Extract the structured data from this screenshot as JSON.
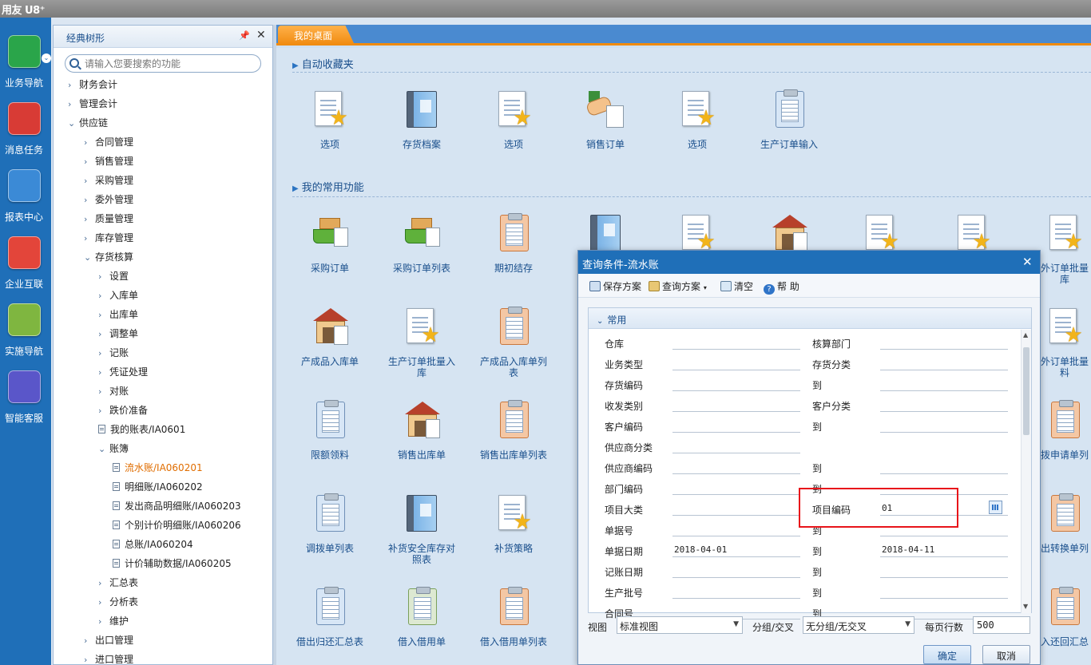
{
  "app": {
    "logo": "用友 U8⁺"
  },
  "rail": [
    {
      "label": "业务导航",
      "icon": "business-nav-icon",
      "color": "#2aa54a"
    },
    {
      "label": "消息任务",
      "icon": "message-icon",
      "color": "#d83b35"
    },
    {
      "label": "报表中心",
      "icon": "report-icon",
      "color": "#3b8ad6"
    },
    {
      "label": "企业互联",
      "icon": "enterprise-icon",
      "color": "#e3453a"
    },
    {
      "label": "实施导航",
      "icon": "compass-icon",
      "color": "#7fb640"
    },
    {
      "label": "智能客服",
      "icon": "support-icon",
      "color": "#5a56c9"
    }
  ],
  "tree": {
    "title": "经典树形",
    "search_placeholder": "请输入您要搜索的功能",
    "nodes": [
      {
        "label": "财务会计",
        "indent": 0,
        "arrow": "›"
      },
      {
        "label": "管理会计",
        "indent": 0,
        "arrow": "›"
      },
      {
        "label": "供应链",
        "indent": 0,
        "arrow": "⌄"
      },
      {
        "label": "合同管理",
        "indent": 1,
        "arrow": "›"
      },
      {
        "label": "销售管理",
        "indent": 1,
        "arrow": "›"
      },
      {
        "label": "采购管理",
        "indent": 1,
        "arrow": "›"
      },
      {
        "label": "委外管理",
        "indent": 1,
        "arrow": "›"
      },
      {
        "label": "质量管理",
        "indent": 1,
        "arrow": "›"
      },
      {
        "label": "库存管理",
        "indent": 1,
        "arrow": "›"
      },
      {
        "label": "存货核算",
        "indent": 1,
        "arrow": "⌄"
      },
      {
        "label": "设置",
        "indent": 2,
        "arrow": "›"
      },
      {
        "label": "入库单",
        "indent": 2,
        "arrow": "›"
      },
      {
        "label": "出库单",
        "indent": 2,
        "arrow": "›"
      },
      {
        "label": "调整单",
        "indent": 2,
        "arrow": "›"
      },
      {
        "label": "记账",
        "indent": 2,
        "arrow": "›"
      },
      {
        "label": "凭证处理",
        "indent": 2,
        "arrow": "›"
      },
      {
        "label": "对账",
        "indent": 2,
        "arrow": "›"
      },
      {
        "label": "跌价准备",
        "indent": 2,
        "arrow": "›"
      },
      {
        "label": "我的账表/IA0601",
        "indent": 2,
        "arrow": "doc"
      },
      {
        "label": "账簿",
        "indent": 2,
        "arrow": "⌄"
      },
      {
        "label": "流水账/IA060201",
        "indent": 3,
        "arrow": "doc",
        "active": true
      },
      {
        "label": "明细账/IA060202",
        "indent": 3,
        "arrow": "doc"
      },
      {
        "label": "发出商品明细账/IA060203",
        "indent": 3,
        "arrow": "doc"
      },
      {
        "label": "个别计价明细账/IA060206",
        "indent": 3,
        "arrow": "doc"
      },
      {
        "label": "总账/IA060204",
        "indent": 3,
        "arrow": "doc"
      },
      {
        "label": "计价辅助数据/IA060205",
        "indent": 3,
        "arrow": "doc"
      },
      {
        "label": "汇总表",
        "indent": 2,
        "arrow": "›"
      },
      {
        "label": "分析表",
        "indent": 2,
        "arrow": "›"
      },
      {
        "label": "维护",
        "indent": 2,
        "arrow": "›"
      },
      {
        "label": "出口管理",
        "indent": 1,
        "arrow": "›"
      },
      {
        "label": "进口管理",
        "indent": 1,
        "arrow": "›"
      }
    ]
  },
  "tabs": [
    {
      "label": "我的桌面"
    }
  ],
  "sections": {
    "favorites": "自动收藏夹",
    "common": "我的常用功能"
  },
  "favorites": [
    {
      "label": "选项",
      "icon": "doc-star-icon"
    },
    {
      "label": "存货档案",
      "icon": "book-icon"
    },
    {
      "label": "选项",
      "icon": "doc-star-icon"
    },
    {
      "label": "销售订单",
      "icon": "handshake-icon"
    },
    {
      "label": "选项",
      "icon": "doc-star-icon"
    },
    {
      "label": "生产订单输入",
      "icon": "clipboard-icon"
    }
  ],
  "common": [
    {
      "label": "采购订单",
      "icon": "cart-icon"
    },
    {
      "label": "采购订单列表",
      "icon": "cart-list-icon"
    },
    {
      "label": "期初结存",
      "icon": "clipboard-icon"
    },
    {
      "label": "",
      "icon": "book-icon"
    },
    {
      "label": "",
      "icon": "doc-star-icon"
    },
    {
      "label": "",
      "icon": "warehouse-icon"
    },
    {
      "label": "",
      "icon": "doc-star-icon"
    },
    {
      "label": "",
      "icon": "doc-star-icon"
    },
    {
      "label": "外订单批量",
      "label2": "库",
      "icon": "doc-star-icon"
    },
    {
      "label": "产成品入库单",
      "icon": "warehouse-icon"
    },
    {
      "label": "生产订单批量入",
      "label2": "库",
      "icon": "doc-star-icon"
    },
    {
      "label": "产成品入库单列",
      "label2": "表",
      "icon": "clipboard-icon"
    },
    {
      "label": "外订单批量",
      "label2": "料",
      "icon": "doc-star-icon"
    },
    {
      "label": "限额领料",
      "icon": "clipboard-icon"
    },
    {
      "label": "销售出库单",
      "icon": "warehouse-icon"
    },
    {
      "label": "销售出库单列表",
      "icon": "clipboard-icon"
    },
    {
      "label": "拨申请单列",
      "icon": "clipboard-icon"
    },
    {
      "label": "调拨单列表",
      "icon": "clipboard-icon"
    },
    {
      "label": "补货安全库存对",
      "label2": "照表",
      "icon": "book-icon"
    },
    {
      "label": "补货策略",
      "icon": "doc-star-icon"
    },
    {
      "label": "出转换单列",
      "icon": "clipboard-icon"
    },
    {
      "label": "借出归还汇总表",
      "icon": "clipboard-icon"
    },
    {
      "label": "借入借用单",
      "icon": "clipboard-icon"
    },
    {
      "label": "借入借用单列表",
      "icon": "clipboard-icon"
    },
    {
      "label": "入还回汇总",
      "icon": "clipboard-icon"
    }
  ],
  "dialog": {
    "title": "查询条件-流水账",
    "toolbar": {
      "save": "保存方案",
      "query": "查询方案",
      "clear": "清空",
      "help": "帮 助"
    },
    "group": "常用",
    "fields": [
      {
        "l1": "仓库",
        "v1": "",
        "l2": "核算部门",
        "v2": ""
      },
      {
        "l1": "业务类型",
        "v1": "",
        "l2": "存货分类",
        "v2": ""
      },
      {
        "l1": "存货编码",
        "v1": "",
        "l2": "到",
        "v2": ""
      },
      {
        "l1": "收发类别",
        "v1": "",
        "l2": "客户分类",
        "v2": ""
      },
      {
        "l1": "客户编码",
        "v1": "",
        "l2": "到",
        "v2": ""
      },
      {
        "l1": "供应商分类",
        "v1": "",
        "l2": "",
        "v2": ""
      },
      {
        "l1": "供应商编码",
        "v1": "",
        "l2": "到",
        "v2": ""
      },
      {
        "l1": "部门编码",
        "v1": "",
        "l2": "到",
        "v2": ""
      },
      {
        "l1": "项目大类",
        "v1": "",
        "l2": "项目编码",
        "v2": "01"
      },
      {
        "l1": "单据号",
        "v1": "",
        "l2": "到",
        "v2": ""
      },
      {
        "l1": "单据日期",
        "v1": "2018-04-01",
        "l2": "到",
        "v2": "2018-04-11"
      },
      {
        "l1": "记账日期",
        "v1": "",
        "l2": "到",
        "v2": ""
      },
      {
        "l1": "生产批号",
        "v1": "",
        "l2": "到",
        "v2": ""
      },
      {
        "l1": "合同号",
        "v1": "",
        "l2": "到",
        "v2": ""
      }
    ],
    "footer": {
      "view_label": "视图",
      "view_value": "标准视图",
      "group_label": "分组/交叉",
      "group_value": "无分组/无交叉",
      "rows_label": "每页行数",
      "rows_value": "500",
      "ok": "确定",
      "cancel": "取消"
    }
  }
}
